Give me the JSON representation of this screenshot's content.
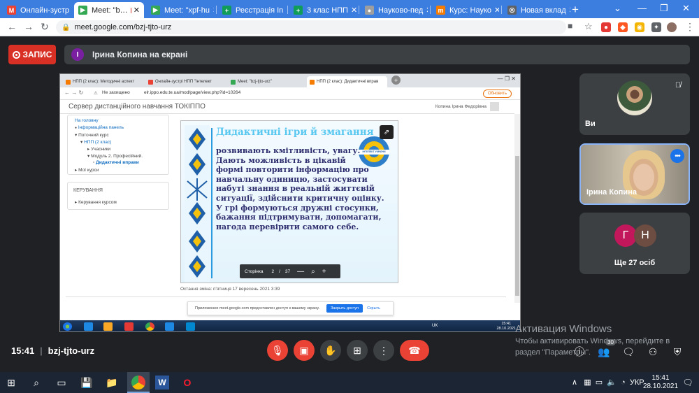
{
  "browser": {
    "tabs": [
      {
        "label": "Онлайн-зустр",
        "color": "#ea4335",
        "glyph": "M"
      },
      {
        "label": "Meet: \"b…",
        "color": "#34a853",
        "glyph": "▶"
      },
      {
        "label": "Meet: \"xpf-hu",
        "color": "#34a853",
        "glyph": "▶"
      },
      {
        "label": "Реєстрація Іn",
        "color": "#0f9d58",
        "glyph": "+"
      },
      {
        "label": "3 клас НПП",
        "color": "#0f9d58",
        "glyph": "+"
      },
      {
        "label": "Науково-пед",
        "color": "#9e9e9e",
        "glyph": "●"
      },
      {
        "label": "Курс: Науко",
        "color": "#f57c00",
        "glyph": "m"
      },
      {
        "label": "Новая вклад",
        "color": "#5f6368",
        "glyph": "◎"
      }
    ],
    "url": "meet.google.com/bzj-tjto-urz"
  },
  "meet": {
    "recording_label": "ЗАПИС",
    "presenter_initial": "І",
    "presenter_text": "Ірина Копина на екрані",
    "meeting_time": "15:41",
    "meeting_code": "bzj-tjto-urz",
    "participants": {
      "me_label": "Ви",
      "irina_label": "Ірина Копина",
      "others_initials": [
        "Г",
        "Н"
      ],
      "others_label": "Ще 27 осіб",
      "people_count": "30"
    }
  },
  "shared": {
    "tabs": [
      "НПП (2 клас): Методичні аспект",
      "Онлайн-зустрі НПП \"Інтелект",
      "Meet: \"bzj-tjto-urz\"",
      "НПП (2 клас): Дидактичні вправ"
    ],
    "not_secure": "Не захищено",
    "url": "elr.ippo.edu.te.ua/mod/page/view.php?id=10264",
    "update_btn": "Обновить",
    "site_name": "Сервер дистанційного навчання ТОКІППО",
    "user_name": "Копина Ірина Федорівна",
    "nav": [
      {
        "text": "На головну",
        "cls": "link"
      },
      {
        "text": "Інформаційна панель",
        "cls": "link",
        "bullet": "●"
      },
      {
        "text": "Поточний курс",
        "cls": "",
        "bullet": "▾"
      },
      {
        "text": "НПП (2 клас)",
        "cls": "link",
        "bullet": "▾"
      },
      {
        "text": "Учасники",
        "cls": "",
        "bullet": "▸"
      },
      {
        "text": "Модуль 2. Професійний.",
        "cls": "",
        "bullet": "▾"
      },
      {
        "text": "Дидактичні вправи",
        "cls": "bold",
        "bullet": "▫"
      },
      {
        "text": "Мої курси",
        "cls": "",
        "bullet": "▸"
      }
    ],
    "admin_title": "КЕРУВАННЯ",
    "admin_item": "Керування курсом",
    "slide": {
      "title": "Дидактичні ігри й змагання",
      "lines": [
        "розвивають кмітливість, увагу.",
        "Дають можливість в цікавій",
        "формі повторити інформацію про",
        "навчальну одиницю, застосувати",
        "набуті знання в реальній життєвій",
        "ситуації, здійснити критичну оцінку.",
        "У грі формуються дружні стосунки,",
        "бажання підтримувати, допомагати,",
        "нагода перевірити самого себе."
      ],
      "logo_text": "ІНТЕЛЕКТ УКРАЇНИ",
      "page_label": "Сторінка",
      "page_current": "2",
      "page_sep": "/",
      "page_total": "37"
    },
    "last_change": "Остання зміна: п'ятниця 17 вересень 2021 3:39",
    "notice_text": "Приложению meet.google.com предоставлен доступ к вашему экрану.",
    "notice_btn": "Закрыть доступ",
    "notice_hide": "Скрыть",
    "taskbar_lang": "UK",
    "taskbar_time": "15:41",
    "taskbar_date": "28.10.2021"
  },
  "activation": {
    "title": "Активация Windows",
    "line1": "Чтобы активировать Windows, перейдите в",
    "line2": "раздел \"Параметры\"."
  },
  "taskbar": {
    "lang": "УКР",
    "time": "15:41",
    "date": "28.10.2021"
  }
}
